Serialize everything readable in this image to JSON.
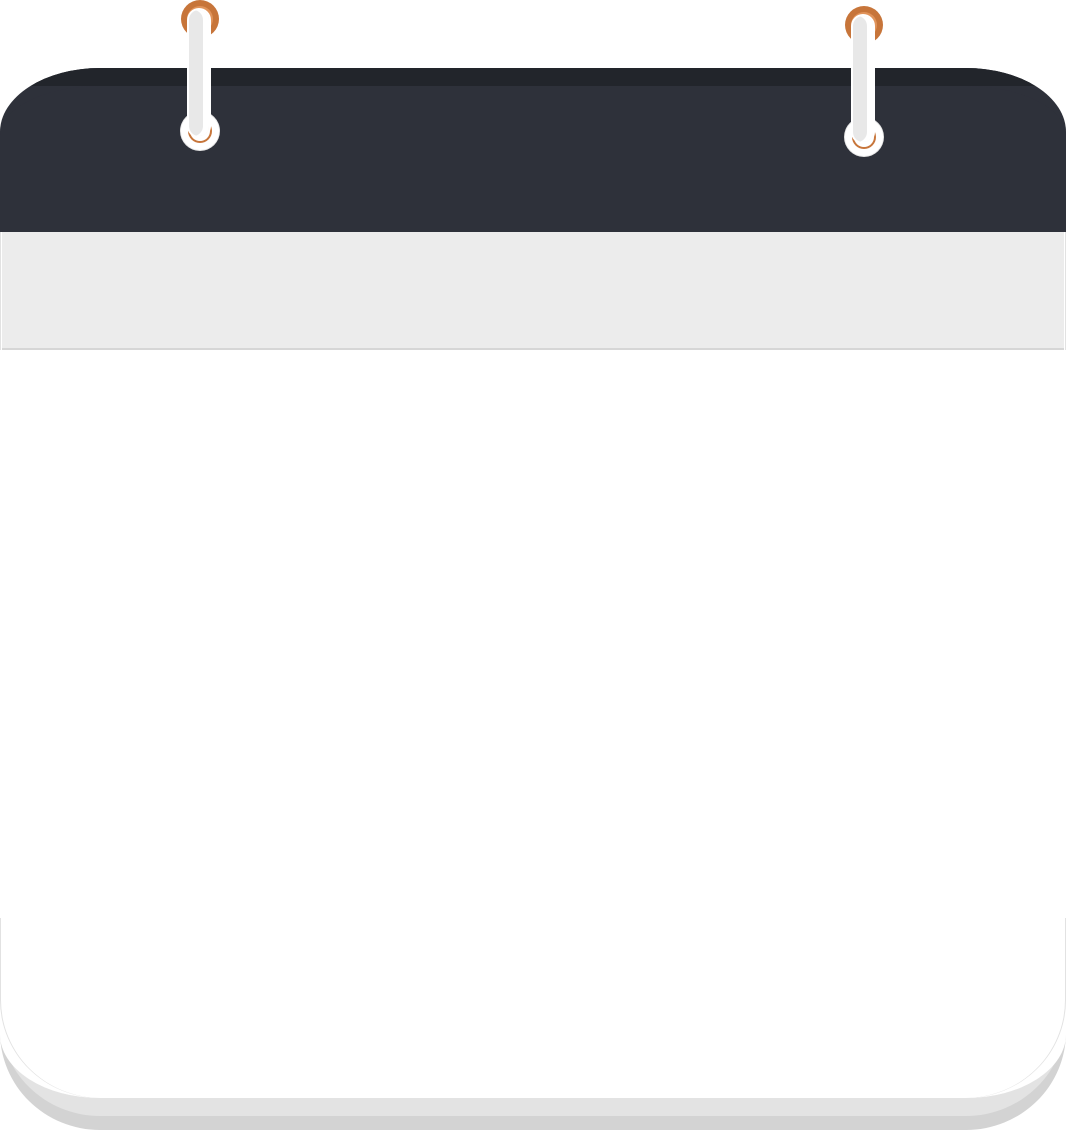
{
  "calendar": {
    "header_color": "#2e313a",
    "subheader_color": "#ececec",
    "page_color": "#ffffff",
    "ring_color": "#c7753a",
    "icon_name": "calendar-icon"
  }
}
